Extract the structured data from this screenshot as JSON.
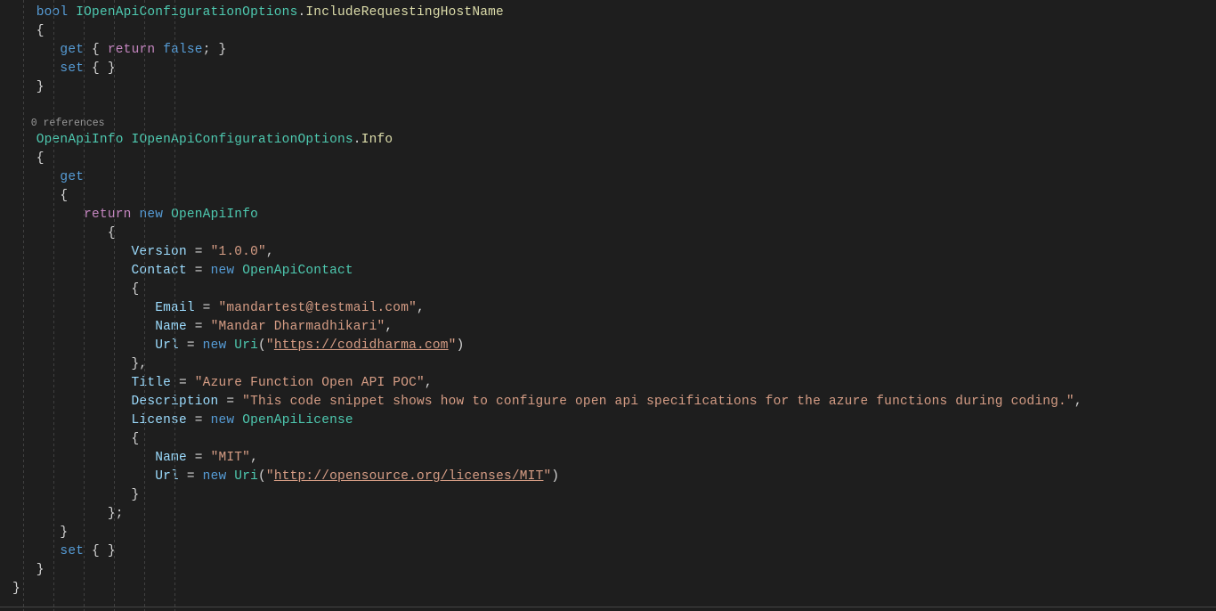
{
  "codelens": {
    "references": "0 references"
  },
  "indent": {
    "i1": "   ",
    "i2": "      ",
    "i3": "         ",
    "i4": "            ",
    "i5": "               ",
    "i6": "                  "
  },
  "keywords": {
    "bool": "bool",
    "get": "get",
    "set": "set",
    "return": "return",
    "false": "false",
    "new": "new"
  },
  "types": {
    "IOpenApiConfigurationOptions": "IOpenApiConfigurationOptions",
    "OpenApiInfo": "OpenApiInfo",
    "OpenApiContact": "OpenApiContact",
    "OpenApiLicense": "OpenApiLicense",
    "Uri": "Uri"
  },
  "members": {
    "IncludeRequestingHostName": "IncludeRequestingHostName",
    "Info": "Info"
  },
  "props": {
    "Version": "Version",
    "Contact": "Contact",
    "Email": "Email",
    "Name": "Name",
    "Url": "Url",
    "Title": "Title",
    "Description": "Description",
    "License": "License"
  },
  "strings": {
    "version": "\"1.0.0\"",
    "email": "\"mandartest@testmail.com\"",
    "contactName": "\"Mandar Dharmadhikari\"",
    "urlPrefix": "\"",
    "contactUrl": "https://codidharma.com",
    "urlSuffix": "\"",
    "title": "\"Azure Function Open API POC\"",
    "description": "\"This code snippet shows how to configure open api specifications for the azure functions during coding.\"",
    "licenseName": "\"MIT\"",
    "licenseUrl": "http://opensource.org/licenses/MIT"
  },
  "punct": {
    "dot": ".",
    "openBrace": "{",
    "closeBrace": "}",
    "closeBraceComma": "},",
    "closeBraceSemi": "};",
    "semi": ";",
    "comma": ",",
    "lparen": "(",
    "rparen": ")",
    "assign": " = ",
    "space": " ",
    "getFalse": " { ",
    "closeGetFalse": "; }",
    "setEmpty": " { }"
  }
}
